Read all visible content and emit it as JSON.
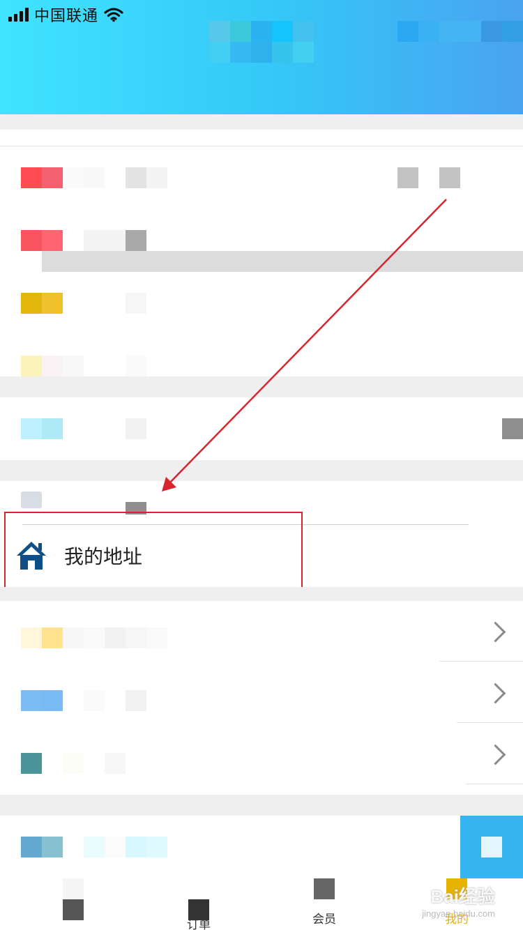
{
  "status_bar": {
    "carrier": "中国联通"
  },
  "address_item": {
    "label": "我的地址",
    "icon": "house-icon"
  },
  "tabs": [
    {
      "label": "订单",
      "active": false
    },
    {
      "label": "会员",
      "active": false
    },
    {
      "label": "我的",
      "active": true
    }
  ],
  "watermark": {
    "brand": "Bai经验",
    "url": "jingyan.baidu.com"
  },
  "colors": {
    "header_start": "#3fe4ff",
    "header_end": "#4aa3f0",
    "highlight": "#d7252d",
    "active_tab": "#e6b300",
    "icon_blue": "#0d4f86"
  }
}
